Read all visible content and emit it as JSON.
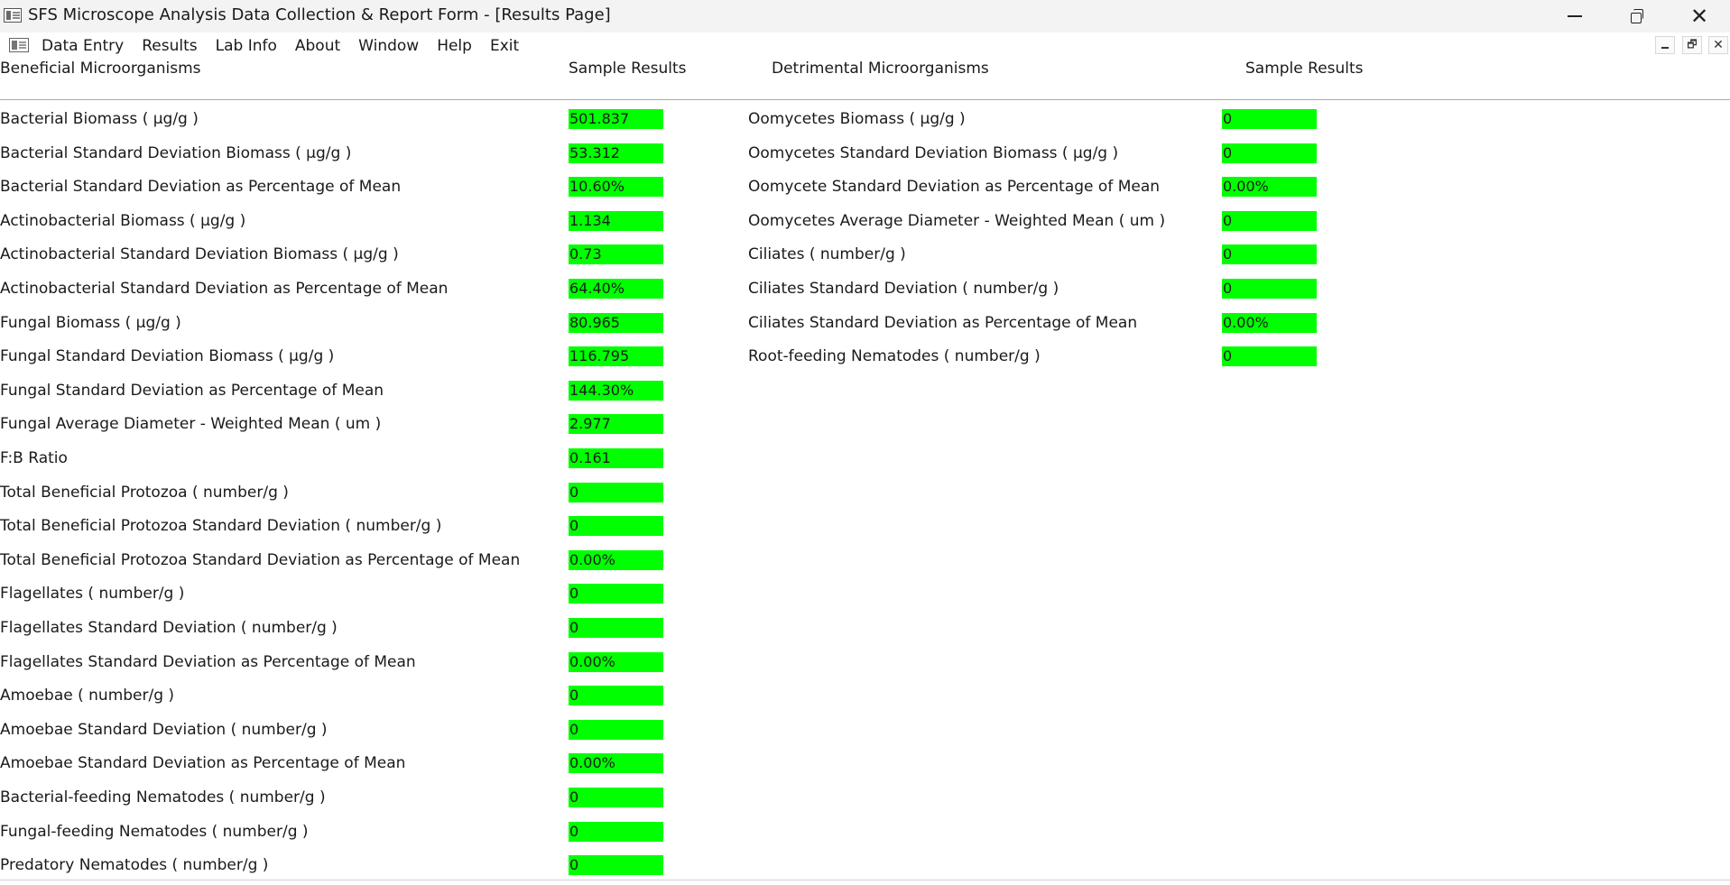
{
  "window": {
    "title": "SFS Microscope Analysis Data Collection & Report Form - [Results Page]"
  },
  "menu": {
    "items": [
      "Data Entry",
      "Results",
      "Lab Info",
      "About",
      "Window",
      "Help",
      "Exit"
    ]
  },
  "headers": {
    "beneficial": "Beneficial Microorganisms",
    "beneficial_results": "Sample Results",
    "detrimental": "Detrimental Microorganisms",
    "detrimental_results": "Sample Results"
  },
  "colors": {
    "value_background": "#00ff00",
    "title_bar": "#f3f3f3",
    "header_rule": "#a8a8a8"
  },
  "beneficial": [
    {
      "label": "Bacterial Biomass ( µg/g )",
      "value": "501.837"
    },
    {
      "label": "Bacterial Standard Deviation Biomass ( µg/g )",
      "value": "53.312"
    },
    {
      "label": "Bacterial Standard Deviation as Percentage of Mean",
      "value": "10.60%"
    },
    {
      "label": "Actinobacterial Biomass ( µg/g )",
      "value": "1.134"
    },
    {
      "label": "Actinobacterial Standard Deviation Biomass ( µg/g )",
      "value": "0.73"
    },
    {
      "label": "Actinobacterial Standard Deviation as Percentage of Mean",
      "value": "64.40%"
    },
    {
      "label": "Fungal Biomass ( µg/g )",
      "value": "80.965"
    },
    {
      "label": "Fungal Standard Deviation Biomass ( µg/g )",
      "value": "116.795"
    },
    {
      "label": "Fungal Standard Deviation as Percentage of Mean",
      "value": "144.30%"
    },
    {
      "label": "Fungal Average Diameter - Weighted Mean ( um )",
      "value": "2.977"
    },
    {
      "label": "F:B Ratio",
      "value": "0.161"
    },
    {
      "label": "Total Beneficial Protozoa ( number/g )",
      "value": "0"
    },
    {
      "label": "Total Beneficial Protozoa Standard Deviation ( number/g )",
      "value": "0"
    },
    {
      "label": "Total Beneficial Protozoa Standard Deviation as Percentage of Mean",
      "value": "0.00%"
    },
    {
      "label": "Flagellates ( number/g )",
      "value": "0"
    },
    {
      "label": "Flagellates Standard Deviation ( number/g )",
      "value": "0"
    },
    {
      "label": "Flagellates Standard Deviation as Percentage of Mean",
      "value": "0.00%"
    },
    {
      "label": "Amoebae ( number/g )",
      "value": "0"
    },
    {
      "label": "Amoebae Standard Deviation ( number/g )",
      "value": "0"
    },
    {
      "label": "Amoebae Standard Deviation as Percentage of Mean",
      "value": "0.00%"
    },
    {
      "label": "Bacterial-feeding Nematodes ( number/g )",
      "value": "0"
    },
    {
      "label": "Fungal-feeding Nematodes ( number/g )",
      "value": "0"
    },
    {
      "label": "Predatory Nematodes ( number/g )",
      "value": "0"
    }
  ],
  "detrimental": [
    {
      "label": "Oomycetes Biomass ( µg/g )",
      "value": "0"
    },
    {
      "label": "Oomycetes Standard Deviation Biomass ( µg/g )",
      "value": "0"
    },
    {
      "label": "Oomycete Standard Deviation as Percentage of Mean",
      "value": "0.00%"
    },
    {
      "label": "Oomycetes Average Diameter - Weighted Mean ( um )",
      "value": "0"
    },
    {
      "label": "Ciliates ( number/g )",
      "value": "0"
    },
    {
      "label": "Ciliates Standard Deviation ( number/g )",
      "value": "0"
    },
    {
      "label": "Ciliates Standard Deviation as Percentage of Mean",
      "value": "0.00%"
    },
    {
      "label": "Root-feeding Nematodes ( number/g )",
      "value": "0"
    }
  ]
}
